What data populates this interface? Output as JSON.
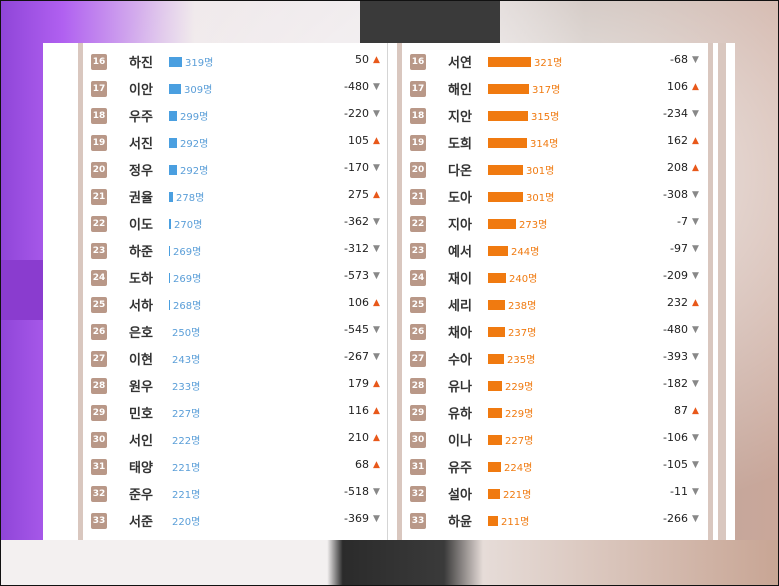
{
  "left_column": [
    {
      "rank": "16",
      "name": "하진",
      "count": "319명",
      "fraction": 0.21,
      "change": "50",
      "dir": "up"
    },
    {
      "rank": "17",
      "name": "이안",
      "count": "309명",
      "fraction": 0.2,
      "change": "-480",
      "dir": "down"
    },
    {
      "rank": "18",
      "name": "우주",
      "count": "299명",
      "fraction": 0.13,
      "change": "-220",
      "dir": "down"
    },
    {
      "rank": "19",
      "name": "서진",
      "count": "292명",
      "fraction": 0.13,
      "change": "105",
      "dir": "up"
    },
    {
      "rank": "20",
      "name": "정우",
      "count": "292명",
      "fraction": 0.13,
      "change": "-170",
      "dir": "down"
    },
    {
      "rank": "21",
      "name": "권율",
      "count": "278명",
      "fraction": 0.06,
      "change": "275",
      "dir": "up"
    },
    {
      "rank": "22",
      "name": "이도",
      "count": "270명",
      "fraction": 0.04,
      "change": "-362",
      "dir": "down"
    },
    {
      "rank": "23",
      "name": "하준",
      "count": "269명",
      "fraction": 0.02,
      "change": "-312",
      "dir": "down"
    },
    {
      "rank": "24",
      "name": "도하",
      "count": "269명",
      "fraction": 0.02,
      "change": "-573",
      "dir": "down"
    },
    {
      "rank": "25",
      "name": "서하",
      "count": "268명",
      "fraction": 0.02,
      "change": "106",
      "dir": "up"
    },
    {
      "rank": "26",
      "name": "은호",
      "count": "250명",
      "fraction": 0,
      "change": "-545",
      "dir": "down"
    },
    {
      "rank": "27",
      "name": "이현",
      "count": "243명",
      "fraction": 0,
      "change": "-267",
      "dir": "down"
    },
    {
      "rank": "28",
      "name": "원우",
      "count": "233명",
      "fraction": 0,
      "change": "179",
      "dir": "up"
    },
    {
      "rank": "29",
      "name": "민호",
      "count": "227명",
      "fraction": 0,
      "change": "116",
      "dir": "up"
    },
    {
      "rank": "30",
      "name": "서인",
      "count": "222명",
      "fraction": 0,
      "change": "210",
      "dir": "up"
    },
    {
      "rank": "31",
      "name": "태양",
      "count": "221명",
      "fraction": 0,
      "change": "68",
      "dir": "up"
    },
    {
      "rank": "32",
      "name": "준우",
      "count": "221명",
      "fraction": 0,
      "change": "-518",
      "dir": "down"
    },
    {
      "rank": "33",
      "name": "서준",
      "count": "220명",
      "fraction": 0,
      "change": "-369",
      "dir": "down"
    }
  ],
  "right_column": [
    {
      "rank": "16",
      "name": "서연",
      "count": "321명",
      "fraction": 0.72,
      "change": "-68",
      "dir": "down"
    },
    {
      "rank": "17",
      "name": "해인",
      "count": "317명",
      "fraction": 0.68,
      "change": "106",
      "dir": "up"
    },
    {
      "rank": "18",
      "name": "지안",
      "count": "315명",
      "fraction": 0.66,
      "change": "-234",
      "dir": "down"
    },
    {
      "rank": "19",
      "name": "도희",
      "count": "314명",
      "fraction": 0.65,
      "change": "162",
      "dir": "up"
    },
    {
      "rank": "20",
      "name": "다온",
      "count": "301명",
      "fraction": 0.58,
      "change": "208",
      "dir": "up"
    },
    {
      "rank": "21",
      "name": "도아",
      "count": "301명",
      "fraction": 0.58,
      "change": "-308",
      "dir": "down"
    },
    {
      "rank": "22",
      "name": "지아",
      "count": "273명",
      "fraction": 0.46,
      "change": "-7",
      "dir": "down"
    },
    {
      "rank": "23",
      "name": "예서",
      "count": "244명",
      "fraction": 0.33,
      "change": "-97",
      "dir": "down"
    },
    {
      "rank": "24",
      "name": "재이",
      "count": "240명",
      "fraction": 0.3,
      "change": "-209",
      "dir": "down"
    },
    {
      "rank": "25",
      "name": "세리",
      "count": "238명",
      "fraction": 0.29,
      "change": "232",
      "dir": "up"
    },
    {
      "rank": "26",
      "name": "채아",
      "count": "237명",
      "fraction": 0.28,
      "change": "-480",
      "dir": "down"
    },
    {
      "rank": "27",
      "name": "수아",
      "count": "235명",
      "fraction": 0.27,
      "change": "-393",
      "dir": "down"
    },
    {
      "rank": "28",
      "name": "유나",
      "count": "229명",
      "fraction": 0.24,
      "change": "-182",
      "dir": "down"
    },
    {
      "rank": "29",
      "name": "유하",
      "count": "229명",
      "fraction": 0.24,
      "change": "87",
      "dir": "up"
    },
    {
      "rank": "30",
      "name": "이나",
      "count": "227명",
      "fraction": 0.23,
      "change": "-106",
      "dir": "down"
    },
    {
      "rank": "31",
      "name": "유주",
      "count": "224명",
      "fraction": 0.21,
      "change": "-105",
      "dir": "down"
    },
    {
      "rank": "32",
      "name": "설아",
      "count": "221명",
      "fraction": 0.2,
      "change": "-11",
      "dir": "down"
    },
    {
      "rank": "33",
      "name": "하윤",
      "count": "211명",
      "fraction": 0.16,
      "change": "-266",
      "dir": "down"
    }
  ],
  "icons": {
    "up": "▲",
    "down": "▼"
  },
  "colors": {
    "boy_bar": "#4a9fe0",
    "girl_bar": "#f07a10",
    "arrow_up": "#e8581a",
    "arrow_down": "#888888"
  }
}
